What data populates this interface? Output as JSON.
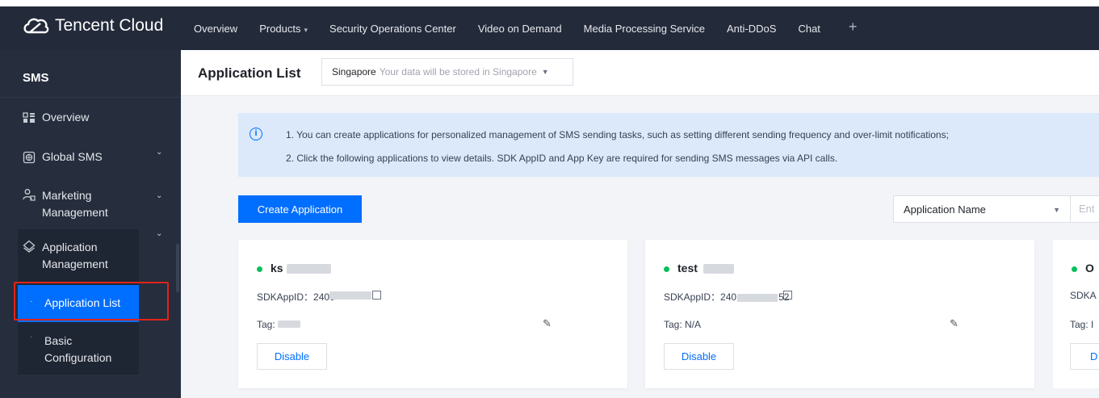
{
  "brand": {
    "name": "Tencent Cloud"
  },
  "topnav": {
    "items": [
      "Overview",
      "Products",
      "Security Operations Center",
      "Video on Demand",
      "Media Processing Service",
      "Anti-DDoS",
      "Chat"
    ],
    "add_icon": "plus-icon"
  },
  "sidebar": {
    "title": "SMS",
    "items": [
      {
        "label": "Overview",
        "icon": "grid-icon"
      },
      {
        "label": "Global SMS",
        "icon": "globe-icon"
      },
      {
        "label_line1": "Marketing",
        "label_line2": "Management",
        "icon": "users-icon"
      },
      {
        "label_line1": "Application",
        "label_line2": "Management",
        "icon": "layers-icon"
      }
    ],
    "subitems": [
      {
        "label": "Application List"
      },
      {
        "label_line1": "Basic",
        "label_line2": "Configuration"
      }
    ]
  },
  "header": {
    "title": "Application List",
    "region_value": "Singapore",
    "region_note": "Your data will be stored in Singapore"
  },
  "notice": {
    "line1": "1. You can create applications for personalized management of SMS sending tasks, such as setting different sending frequency and over-limit notifications;",
    "line2": "2. Click the following applications to view details. SDK AppID and App Key are required for sending SMS messages via API calls."
  },
  "toolbar": {
    "create_label": "Create Application",
    "filter_value": "Application Name",
    "search_placeholder": "Ent"
  },
  "cards": [
    {
      "name_prefix": "ks",
      "sdk_prefix": "SDKAppID：2400",
      "sdk_suffix": "",
      "tag_prefix": "Tag:",
      "disable_label": "Disable"
    },
    {
      "name_prefix": "test",
      "sdk_prefix": "SDKAppID：240",
      "sdk_suffix": "52",
      "tag": "Tag: N/A",
      "disable_label": "Disable"
    },
    {
      "name_prefix": "O",
      "sdk_prefix": "SDKA",
      "tag": "Tag: I",
      "disable_label": "D"
    }
  ],
  "colors": {
    "primary": "#006eff",
    "topbar": "#232a3a",
    "sidebar": "#262e3e",
    "status_on": "#0abf5b",
    "highlight_box": "#e2231a"
  }
}
